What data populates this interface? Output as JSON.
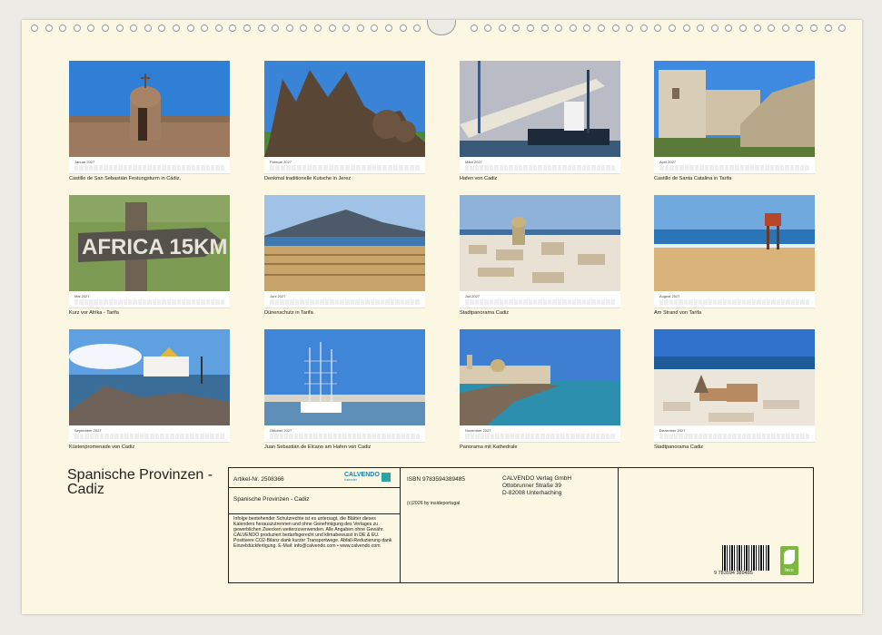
{
  "title": "Spanische Provinzen - Cadiz",
  "months": [
    {
      "name": "Januar 2027",
      "caption": "Castillo de San Sebastián Festungsturm in Cádiz,"
    },
    {
      "name": "Februar 2027",
      "caption": "Denkmal traditionelle Kutsche in Jerez"
    },
    {
      "name": "März 2027",
      "caption": "Hafen von Cadiz"
    },
    {
      "name": "April 2027",
      "caption": "Castillo de Santa Catalina in Tarifa"
    },
    {
      "name": "Mai 2027",
      "caption": "Kurz vor Afrika - Tarifa"
    },
    {
      "name": "Juni 2027",
      "caption": "Dünenschutz in Tarifa"
    },
    {
      "name": "Juli 2027",
      "caption": "Stadtpanorama Cadiz"
    },
    {
      "name": "August 2027",
      "caption": "Am Strand von Tarifa"
    },
    {
      "name": "September 2027",
      "caption": "Küstenpromenade von Cadiz"
    },
    {
      "name": "Oktober 2027",
      "caption": "Juan Sebastián de Elcano am Hafen von Cadiz"
    },
    {
      "name": "November 2027",
      "caption": "Panorama mit Kathedrale"
    },
    {
      "name": "Dezember 2027",
      "caption": "Stadtpanorama Cadiz"
    }
  ],
  "sign_text": "AFRICA 15KM",
  "info": {
    "artikel": "Artikel-Nr. 2508366",
    "brand": "CALVENDO",
    "brand_sub": "Kalender",
    "product_title": "Spanische Provinzen - Cadiz",
    "isbn": "ISBN 9783594389485",
    "publisher_line1": "CALVENDO Verlag GmbH",
    "publisher_line2": "Ottobrunner Straße 39",
    "publisher_line3": "D-82008 Unterhaching",
    "copyright": "(c)2026 by insideportugal",
    "legal": "Infolge bestehender Schutzrechte ist es untersagt, die Blätter dieses Kalenders herauszutrennen und ohne Genehmigung des Verlages zu gewerblichen Zwecken weiterzuverwenden. Alle Angaben ohne Gewähr. CALVENDO produziert bedarfsgerecht und klimabewusst in DE & EU. Positivere CO2-Bilanz dank kurzer Transportwege. Abfall-Reduzierung dank Einzelstückfertigung. E-Mail: info@calvendo.com • www.calvendo.com",
    "barcode_number": "9 783594 389485",
    "eco_label": "feco"
  }
}
